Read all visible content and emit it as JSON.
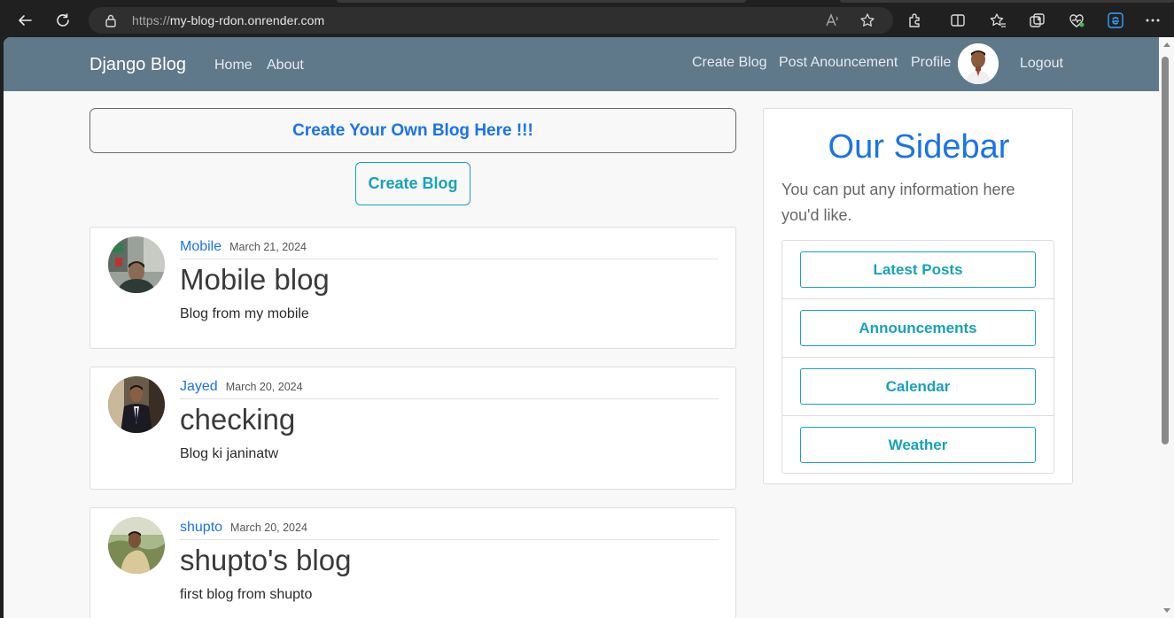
{
  "browser": {
    "url_protocol": "https://",
    "url_host": "my-blog-rdon.onrender.com"
  },
  "navbar": {
    "brand": "Django Blog",
    "left_links": [
      "Home",
      "About"
    ],
    "right_links": [
      "Create Blog",
      "Post Anouncement",
      "Profile"
    ],
    "logout": "Logout"
  },
  "main": {
    "banner": "Create Your Own Blog Here !!!",
    "create_button": "Create Blog",
    "posts": [
      {
        "author": "Mobile",
        "date": "March 21, 2024",
        "title": "Mobile blog",
        "body": "Blog from my mobile"
      },
      {
        "author": "Jayed",
        "date": "March 20, 2024",
        "title": "checking",
        "body": "Blog ki janinatw"
      },
      {
        "author": "shupto",
        "date": "March 20, 2024",
        "title": "shupto's blog",
        "body": "first blog from shupto"
      }
    ]
  },
  "sidebar": {
    "title": "Our Sidebar",
    "text": "You can put any information here you'd like.",
    "buttons": [
      "Latest Posts",
      "Announcements",
      "Calendar",
      "Weather"
    ]
  },
  "colors": {
    "navbar_bg": "#5f788a",
    "link_blue": "#1a73e8",
    "info_teal": "#17a2b8"
  }
}
